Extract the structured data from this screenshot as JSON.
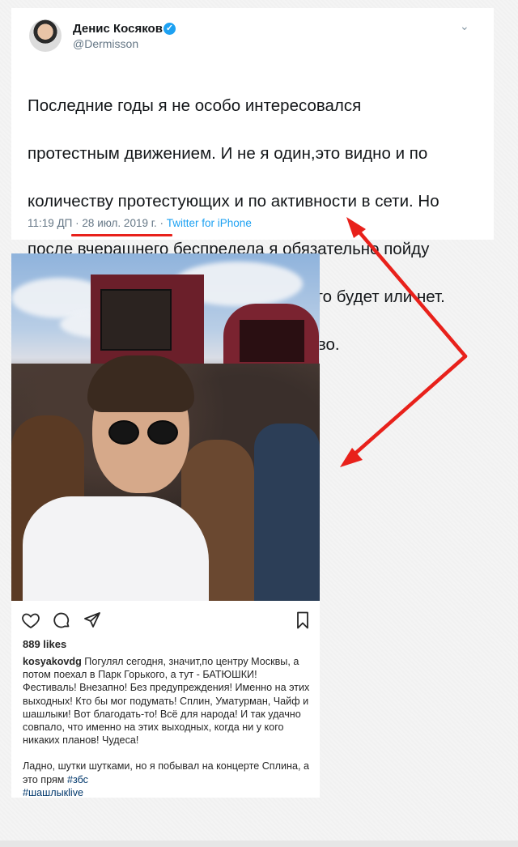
{
  "tweet": {
    "author_name": "Денис Косяков",
    "handle": "@Dermisson",
    "verified_icon": "verified-check-icon",
    "menu_icon": "chevron-down-icon",
    "text_lines": [
      "Последние годы я не особо интересовался",
      "протестным движением. И не я один,это видно и по",
      "количеству протестующих  и по активности в сети. Но",
      "после вчерашнего беспредела я обязательно пойду",
      "на улицу, и мне плевать разрешено это будет или нет.",
      "Это моя страна, моя улица и моё право."
    ],
    "time": "11:19 ДП",
    "date": "28 июл. 2019 г.",
    "source": "Twitter for iPhone",
    "separator": "·",
    "colors": {
      "link": "#1da1f2",
      "muted": "#657786",
      "underline": "#e8211b"
    }
  },
  "instagram": {
    "icons": [
      "heart-icon",
      "comment-icon",
      "share-icon",
      "bookmark-icon"
    ],
    "likes": "889 likes",
    "username": "kosyakovdg",
    "caption_first": "Погулял сегодня, значит,по центру Москвы, а потом поехал в Парк Горького, а тут - БАТЮШКИ! Фестиваль! Внезапно! Без предупреждения! Именно на этих выходных! Кто бы мог подумать! Сплин, Уматурман, Чайф и шашлыки! Вот благодать-то! Всё для народа! И так удачно совпало, что именно на этих выходных, когда ни у кого никаких планов! Чудеса!",
    "caption_second": "Ладно, шутки шутками, но я побывал на концерте Сплина, а это прям",
    "hashtag1": "#збс",
    "hashtag2": "#шашлыкlive"
  },
  "annotation": {
    "arrow_color": "#e8211b"
  }
}
